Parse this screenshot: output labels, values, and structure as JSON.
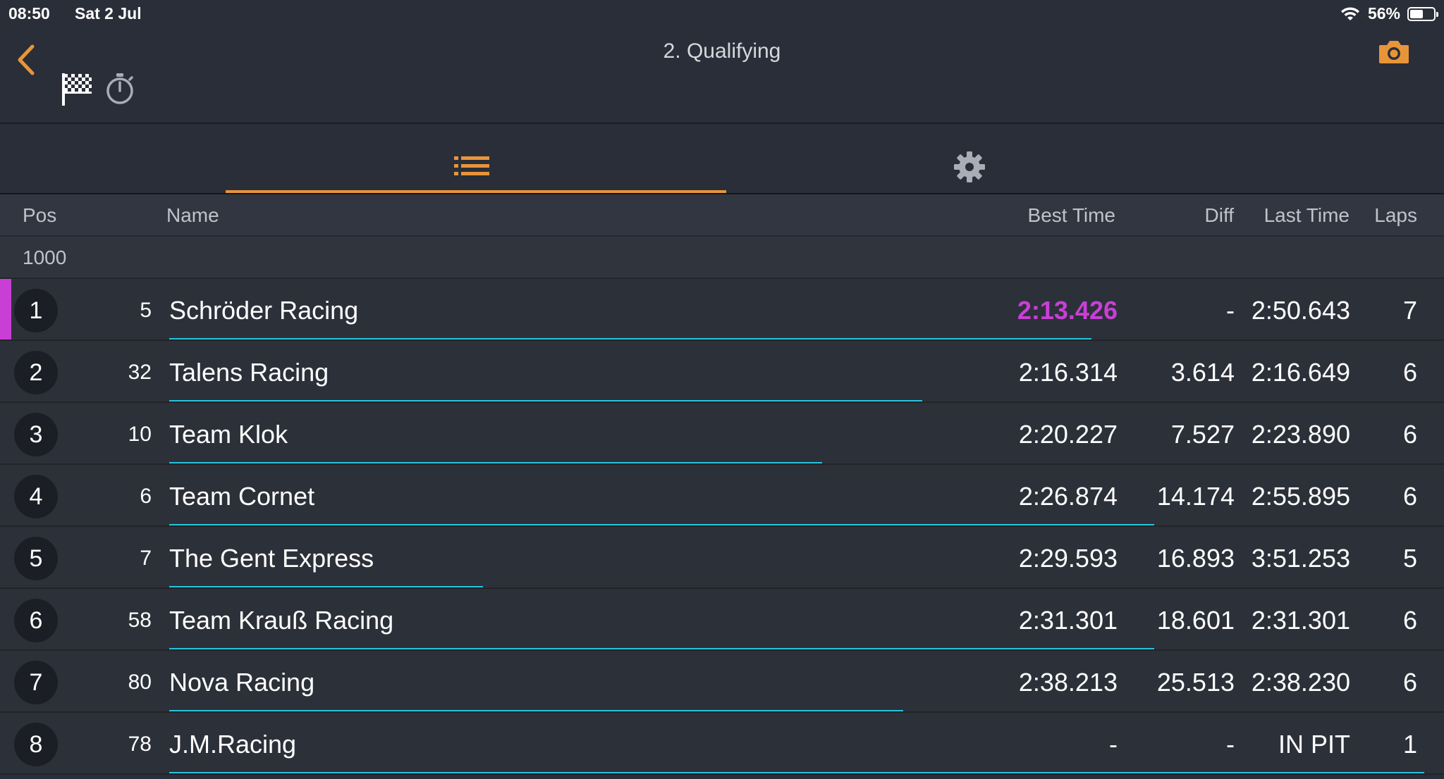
{
  "status_bar": {
    "time": "08:50",
    "date": "Sat 2 Jul",
    "battery_text": "56%",
    "battery_level": 0.56
  },
  "header": {
    "title": "2. Qualifying",
    "accent_color": "#e8953a"
  },
  "tabs": [
    {
      "icon": "list-icon",
      "active": true
    },
    {
      "icon": "gear-icon",
      "active": false
    }
  ],
  "columns": {
    "pos": "Pos",
    "name": "Name",
    "best_time": "Best Time",
    "diff": "Diff",
    "last_time": "Last Time",
    "laps": "Laps"
  },
  "group": {
    "label": "1000"
  },
  "colors": {
    "fastest": "#c93fd6",
    "progress": "#27c3dd"
  },
  "rows": [
    {
      "pos": "1",
      "num": "5",
      "name": "Schröder Racing",
      "best": "2:13.426",
      "diff": "-",
      "last": "2:50.643",
      "laps": "7",
      "progress": 0.735,
      "fastest": true
    },
    {
      "pos": "2",
      "num": "32",
      "name": "Talens Racing",
      "best": "2:16.314",
      "diff": "3.614",
      "last": "2:16.649",
      "laps": "6",
      "progress": 0.6,
      "fastest": false
    },
    {
      "pos": "3",
      "num": "10",
      "name": "Team Klok",
      "best": "2:20.227",
      "diff": "7.527",
      "last": "2:23.890",
      "laps": "6",
      "progress": 0.52,
      "fastest": false
    },
    {
      "pos": "4",
      "num": "6",
      "name": "Team Cornet",
      "best": "2:26.874",
      "diff": "14.174",
      "last": "2:55.895",
      "laps": "6",
      "progress": 0.785,
      "fastest": false
    },
    {
      "pos": "5",
      "num": "7",
      "name": "The Gent Express",
      "best": "2:29.593",
      "diff": "16.893",
      "last": "3:51.253",
      "laps": "5",
      "progress": 0.25,
      "fastest": false
    },
    {
      "pos": "6",
      "num": "58",
      "name": "Team Krauß Racing",
      "best": "2:31.301",
      "diff": "18.601",
      "last": "2:31.301",
      "laps": "6",
      "progress": 0.785,
      "fastest": false
    },
    {
      "pos": "7",
      "num": "80",
      "name": "Nova Racing",
      "best": "2:38.213",
      "diff": "25.513",
      "last": "2:38.230",
      "laps": "6",
      "progress": 0.585,
      "fastest": false
    },
    {
      "pos": "8",
      "num": "78",
      "name": "J.M.Racing",
      "best": "-",
      "diff": "-",
      "last": "IN PIT",
      "laps": "1",
      "progress": 1.0,
      "fastest": false
    }
  ]
}
